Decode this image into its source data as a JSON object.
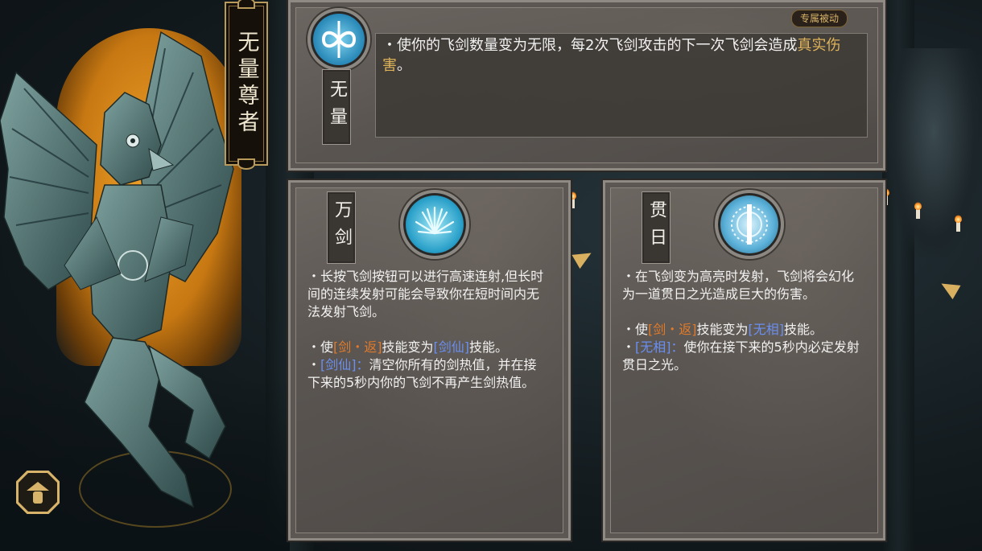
{
  "character": {
    "title": "无量尊者"
  },
  "exclusive_passive": {
    "badge": "专属被动",
    "name": "无量",
    "icon": "infinity-sword-icon",
    "desc_pre": "・使你的飞剑数量变为无限，每2次飞剑攻击的下一次飞剑会造成",
    "desc_highlight": "真实伤害",
    "desc_post": "。"
  },
  "skill_left": {
    "name": "万剑",
    "icon": "myriad-swords-icon",
    "intro": "・长按飞剑按钮可以进行高速连射,但长时间的连续发射可能会导致你在短时间内无法发射飞剑。",
    "line1_pre": "・使",
    "line1_from": "[剑・返]",
    "line1_mid": "技能变为",
    "line1_to": "[剑仙]",
    "line1_post": "技能。",
    "line2_tag": "[剑仙]：",
    "line2_text": "清空你所有的剑热值，并在接下来的5秒内你的飞剑不再产生剑热值。"
  },
  "skill_right": {
    "name": "贯日",
    "icon": "sun-piercing-icon",
    "intro": "・在飞剑变为高亮时发射，飞剑将会幻化为一道贯日之光造成巨大的伤害。",
    "line1_pre": "・使",
    "line1_from": "[剑・返]",
    "line1_mid": "技能变为",
    "line1_to": "[无相]",
    "line1_post": "技能。",
    "line2_tag": "[无相]：",
    "line2_text": "使你在接下来的5秒内必定发射贯日之光。"
  },
  "colors": {
    "gold": "#e0b45a",
    "orange": "#e07a2a",
    "blue": "#6a8ff0"
  },
  "controls": {
    "prev_arrow": "left-arrow-icon",
    "next_arrow": "right-arrow-icon",
    "hat_button": "straw-hat-icon"
  }
}
